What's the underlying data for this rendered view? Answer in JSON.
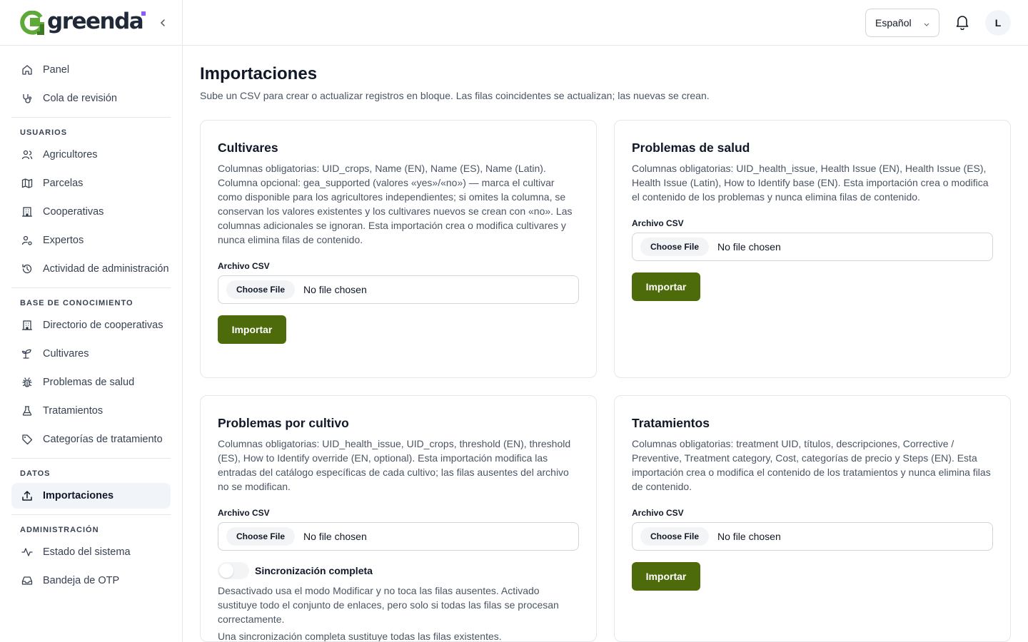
{
  "brand": {
    "name": "greenda",
    "accent": "#4d6b0a",
    "logo_green": "#5fa83a",
    "logo_dot": "#8b5cf6"
  },
  "sidebar": {
    "top_items": [
      {
        "label": "Panel",
        "icon": "home-icon"
      },
      {
        "label": "Cola de revisión",
        "icon": "stethoscope-icon"
      }
    ],
    "sections": [
      {
        "title": "USUARIOS",
        "items": [
          {
            "label": "Agricultores",
            "icon": "users-icon"
          },
          {
            "label": "Parcelas",
            "icon": "map-icon"
          },
          {
            "label": "Cooperativas",
            "icon": "building-icon"
          },
          {
            "label": "Expertos",
            "icon": "user-cog-icon"
          },
          {
            "label": "Actividad de administración",
            "icon": "history-icon"
          }
        ]
      },
      {
        "title": "BASE DE CONOCIMIENTO",
        "items": [
          {
            "label": "Directorio de cooperativas",
            "icon": "building-icon"
          },
          {
            "label": "Cultivares",
            "icon": "sprout-icon"
          },
          {
            "label": "Problemas de salud",
            "icon": "bug-icon"
          },
          {
            "label": "Tratamientos",
            "icon": "flask-icon"
          },
          {
            "label": "Categorías de tratamiento",
            "icon": "tag-icon"
          }
        ]
      },
      {
        "title": "DATOS",
        "items": [
          {
            "label": "Importaciones",
            "icon": "upload-icon",
            "active": true
          }
        ]
      },
      {
        "title": "ADMINISTRACIÓN",
        "items": [
          {
            "label": "Estado del sistema",
            "icon": "activity-icon"
          },
          {
            "label": "Bandeja de OTP",
            "icon": "inbox-icon"
          }
        ]
      }
    ]
  },
  "topbar": {
    "language": "Español",
    "avatar_initial": "L"
  },
  "page": {
    "title": "Importaciones",
    "subtitle": "Sube un CSV para crear o actualizar registros en bloque. Las filas coincidentes se actualizan; las nuevas se crean."
  },
  "cards": {
    "cultivars": {
      "title": "Cultivares",
      "description": "Columnas obligatorias: UID_crops, Name (EN), Name (ES), Name (Latin). Columna opcional: gea_supported (valores «yes»/«no») — marca el cultivar como disponible para los agricultores independientes; si omites la columna, se conservan los valores existentes y los cultivares nuevos se crean con «no». Las columnas adicionales se ignoran. Esta importación crea o modifica cultivares y nunca elimina filas de contenido.",
      "field_label": "Archivo CSV",
      "choose_label": "Choose File",
      "file_status": "No file chosen",
      "button": "Importar"
    },
    "health": {
      "title": "Problemas de salud",
      "description": "Columnas obligatorias: UID_health_issue, Health Issue (EN), Health Issue (ES), Health Issue (Latin), How to Identify base (EN). Esta importación crea o modifica el contenido de los problemas y nunca elimina filas de contenido.",
      "field_label": "Archivo CSV",
      "choose_label": "Choose File",
      "file_status": "No file chosen",
      "button": "Importar"
    },
    "crop_issues": {
      "title": "Problemas por cultivo",
      "description": "Columnas obligatorias: UID_health_issue, UID_crops, threshold (EN), threshold (ES), How to Identify override (EN, optional). Esta importación modifica las entradas del catálogo específicas de cada cultivo; las filas ausentes del archivo no se modifican.",
      "field_label": "Archivo CSV",
      "choose_label": "Choose File",
      "file_status": "No file chosen",
      "toggle_label": "Sincronización completa",
      "toggle_on": false,
      "toggle_help": "Desactivado usa el modo Modificar y no toca las filas ausentes. Activado sustituye todo el conjunto de enlaces, pero solo si todas las filas se procesan correctamente.",
      "extra_note": "Una sincronización completa sustituye todas las filas existentes."
    },
    "treatments": {
      "title": "Tratamientos",
      "description": "Columnas obligatorias: treatment UID, títulos, descripciones, Corrective / Preventive, Treatment category, Cost, categorías de precio y Steps (EN). Esta importación crea o modifica el contenido de los tratamientos y nunca elimina filas de contenido.",
      "field_label": "Archivo CSV",
      "choose_label": "Choose File",
      "file_status": "No file chosen",
      "button": "Importar"
    }
  }
}
